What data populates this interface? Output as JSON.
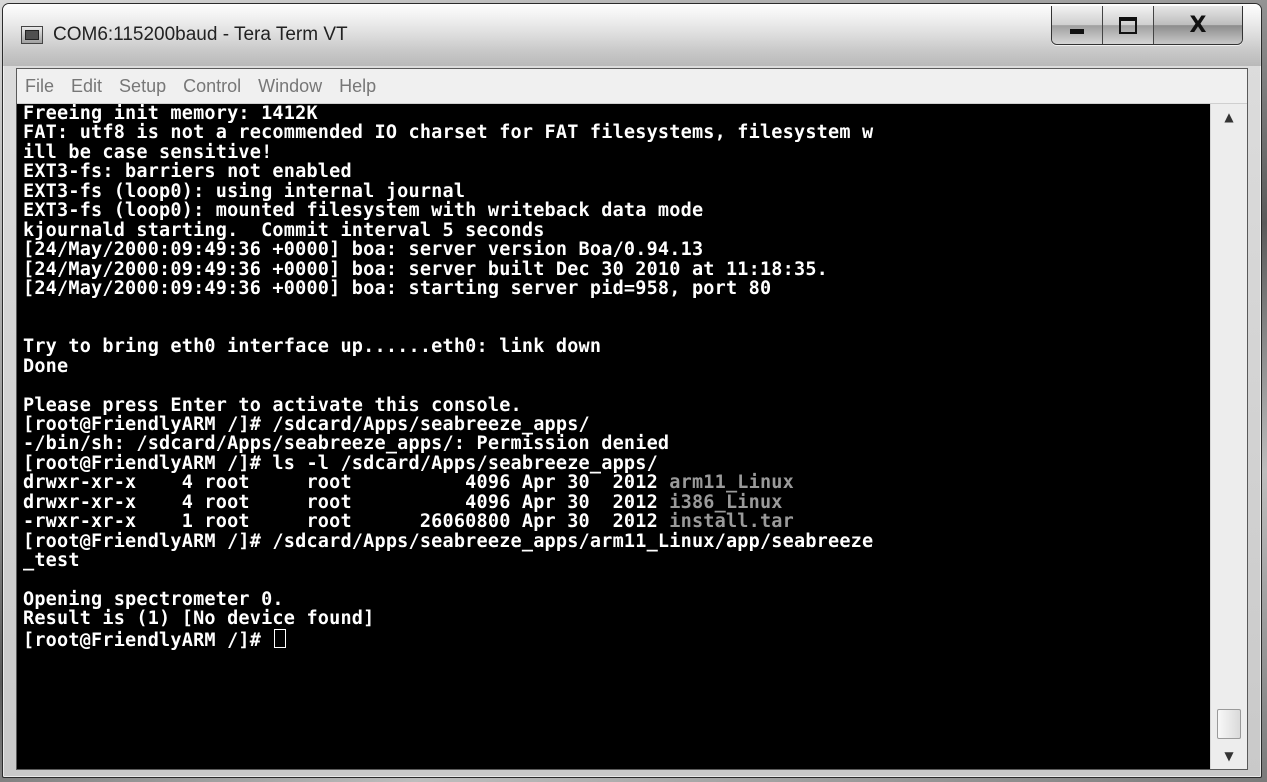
{
  "window": {
    "title": "COM6:115200baud - Tera Term VT",
    "icons": {
      "app": "tera-term-icon",
      "minimize": "minimize-icon",
      "maximize": "maximize-icon",
      "close": "close-icon"
    },
    "close_glyph": "X"
  },
  "menu": [
    "File",
    "Edit",
    "Setup",
    "Control",
    "Window",
    "Help"
  ],
  "terminal": {
    "lines": [
      "Freeing init memory: 1412K",
      "FAT: utf8 is not a recommended IO charset for FAT filesystems, filesystem w",
      "ill be case sensitive!",
      "EXT3-fs: barriers not enabled",
      "EXT3-fs (loop0): using internal journal",
      "EXT3-fs (loop0): mounted filesystem with writeback data mode",
      "kjournald starting.  Commit interval 5 seconds",
      "[24/May/2000:09:49:36 +0000] boa: server version Boa/0.94.13",
      "[24/May/2000:09:49:36 +0000] boa: server built Dec 30 2010 at 11:18:35.",
      "[24/May/2000:09:49:36 +0000] boa: starting server pid=958, port 80",
      "",
      "",
      "Try to bring eth0 interface up......eth0: link down",
      "Done",
      "",
      "Please press Enter to activate this console.",
      "[root@FriendlyARM /]# /sdcard/Apps/seabreeze_apps/",
      "-/bin/sh: /sdcard/Apps/seabreeze_apps/: Permission denied",
      "[root@FriendlyARM /]# ls -l /sdcard/Apps/seabreeze_apps/"
    ],
    "listing": [
      {
        "prefix": "drwxr-xr-x    4 root     root          4096 Apr 30  2012 ",
        "name": "arm11_Linux"
      },
      {
        "prefix": "drwxr-xr-x    4 root     root          4096 Apr 30  2012 ",
        "name": "i386_Linux"
      },
      {
        "prefix": "-rwxr-xr-x    1 root     root      26060800 Apr 30  2012 ",
        "name": "install.tar"
      }
    ],
    "lines_after": [
      "[root@FriendlyARM /]# /sdcard/Apps/seabreeze_apps/arm11_Linux/app/seabreeze",
      "_test",
      "",
      "Opening spectrometer 0.",
      "Result is (1) [No device found]"
    ],
    "prompt": "[root@FriendlyARM /]# "
  },
  "scrollbar": {
    "up_icon": "scroll-up-arrow-icon",
    "down_icon": "scroll-down-arrow-icon"
  }
}
